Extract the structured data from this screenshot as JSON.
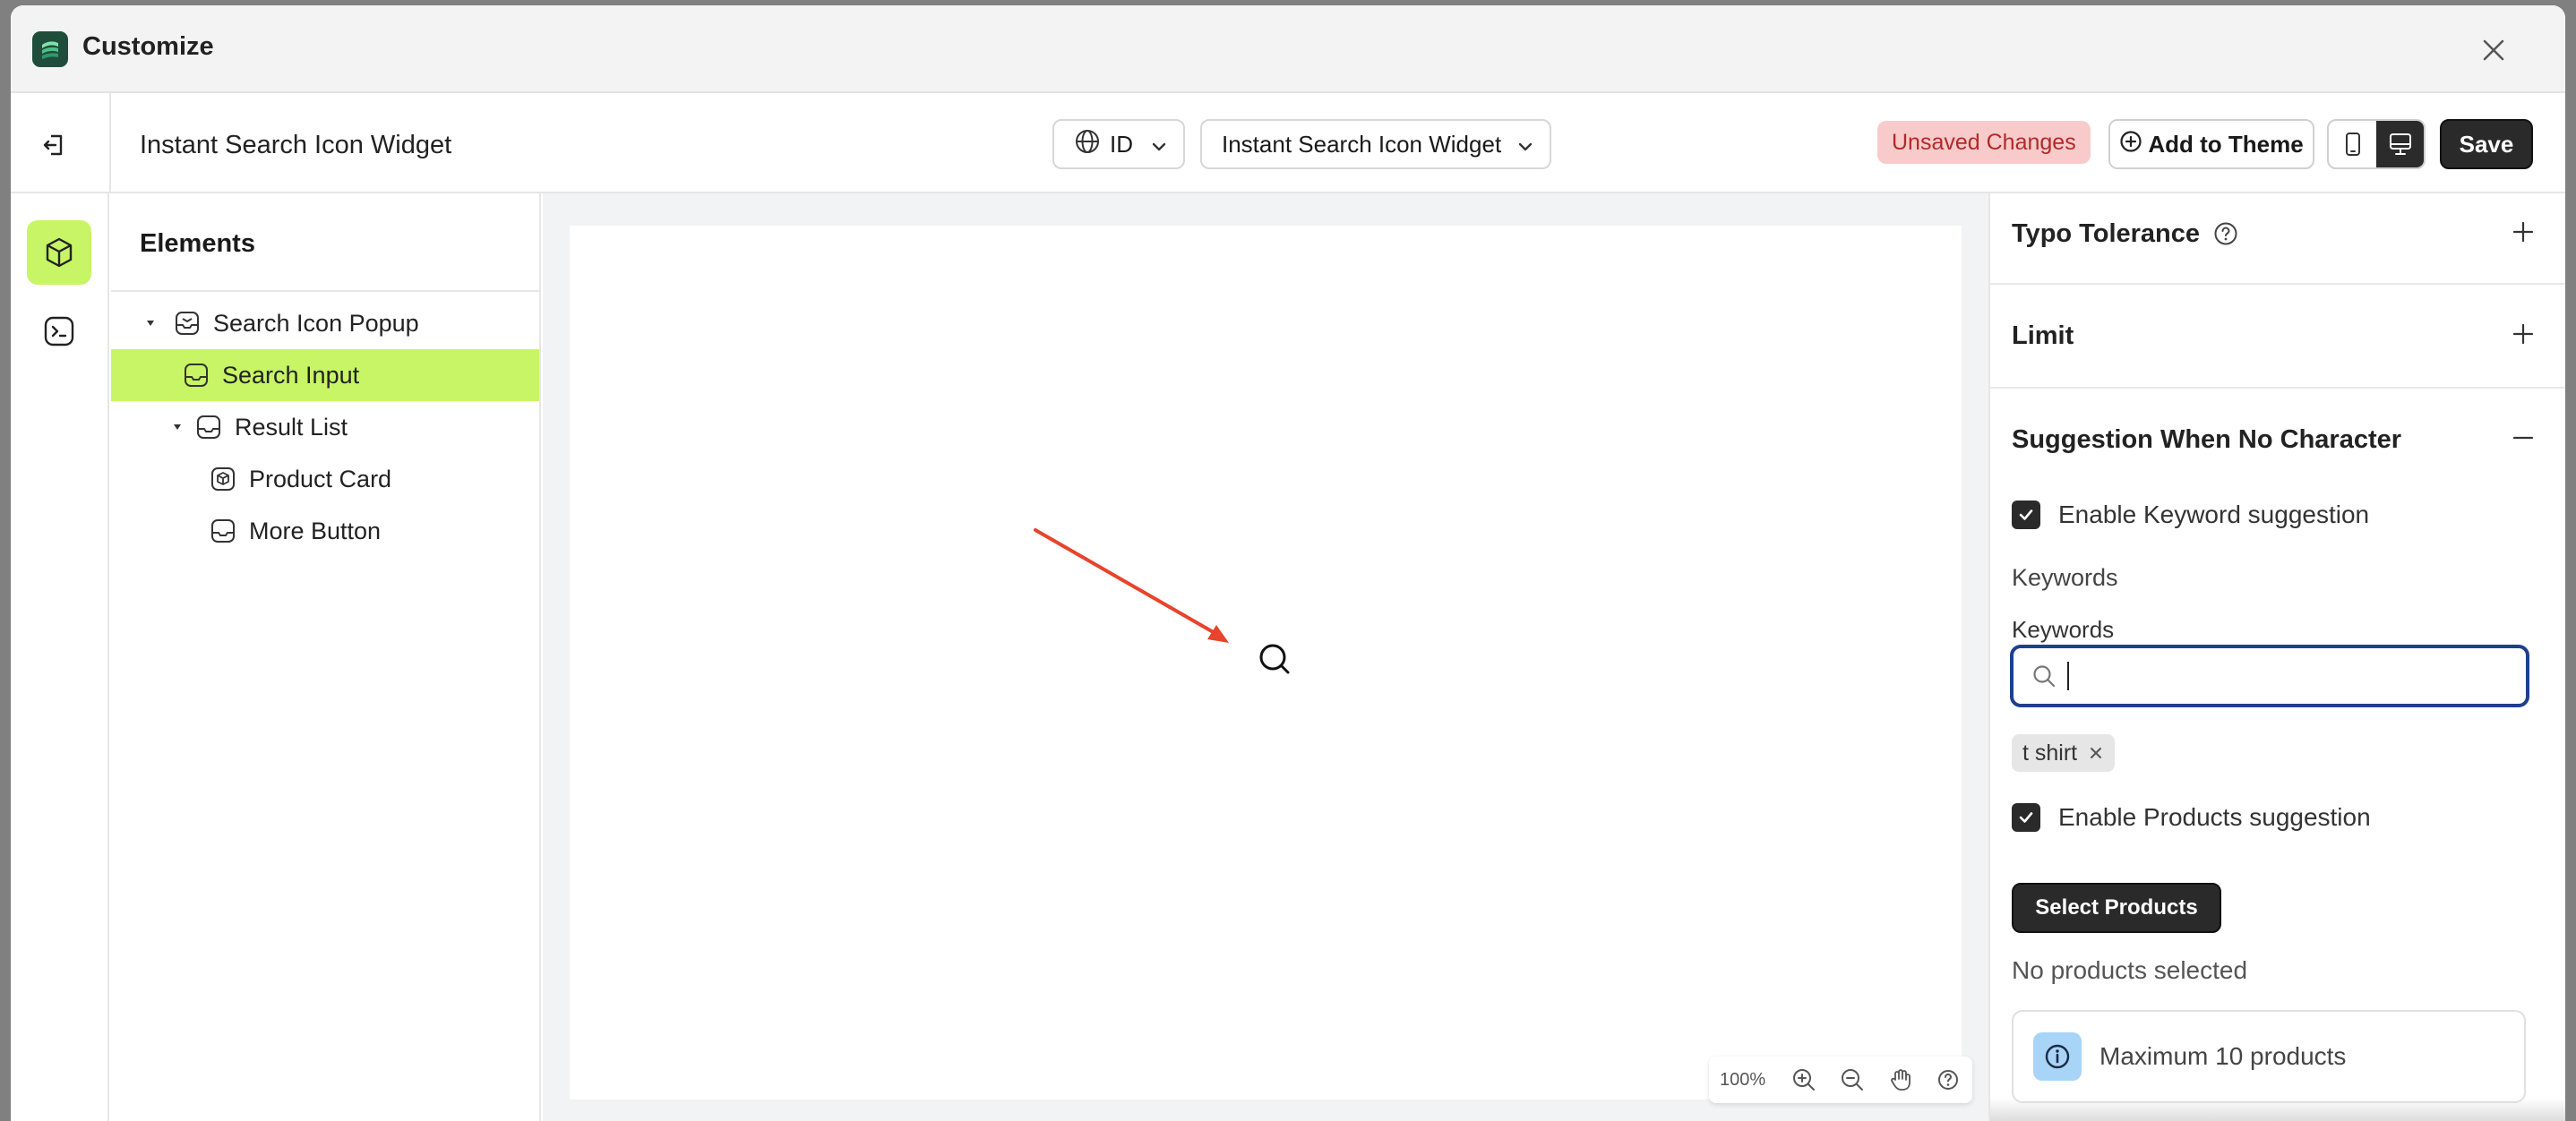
{
  "window": {
    "title": "Customize"
  },
  "toolbar": {
    "page_name": "Instant Search Icon Widget",
    "language_value": "ID",
    "widget_value": "Instant Search Icon Widget",
    "unsaved_label": "Unsaved Changes",
    "add_to_theme_label": "Add to Theme",
    "save_label": "Save"
  },
  "elements": {
    "title": "Elements",
    "tree": [
      {
        "label": "Search Icon Popup",
        "level": 0,
        "expanded": true,
        "selected": false
      },
      {
        "label": "Search Input",
        "level": 1,
        "expanded": false,
        "selected": true
      },
      {
        "label": "Result List",
        "level": 1,
        "expanded": true,
        "selected": false
      },
      {
        "label": "Product Card",
        "level": 2,
        "expanded": false,
        "selected": false
      },
      {
        "label": "More Button",
        "level": 2,
        "expanded": false,
        "selected": false
      }
    ]
  },
  "canvas": {
    "zoom_level": "100%"
  },
  "settings": {
    "typo_tolerance": "Typo Tolerance",
    "limit": "Limit",
    "suggestion_section": "Suggestion When No Character",
    "enable_keyword_label": "Enable Keyword suggestion",
    "keywords_heading": "Keywords",
    "keywords_field_label": "Keywords",
    "keywords_input_value": "",
    "keyword_tags": [
      "t shirt"
    ],
    "enable_products_label": "Enable Products suggestion",
    "select_products_label": "Select Products",
    "no_products_text": "No products selected",
    "info_text": "Maximum 10 products"
  },
  "colors": {
    "accent": "#c7f565",
    "dark_button": "#2a2a2a",
    "unsaved_bg": "#f8caca",
    "unsaved_text": "#b02a2a",
    "input_focus": "#1f3f8f",
    "arrow": "#e8432b",
    "info_bg": "#a8d4f7"
  }
}
